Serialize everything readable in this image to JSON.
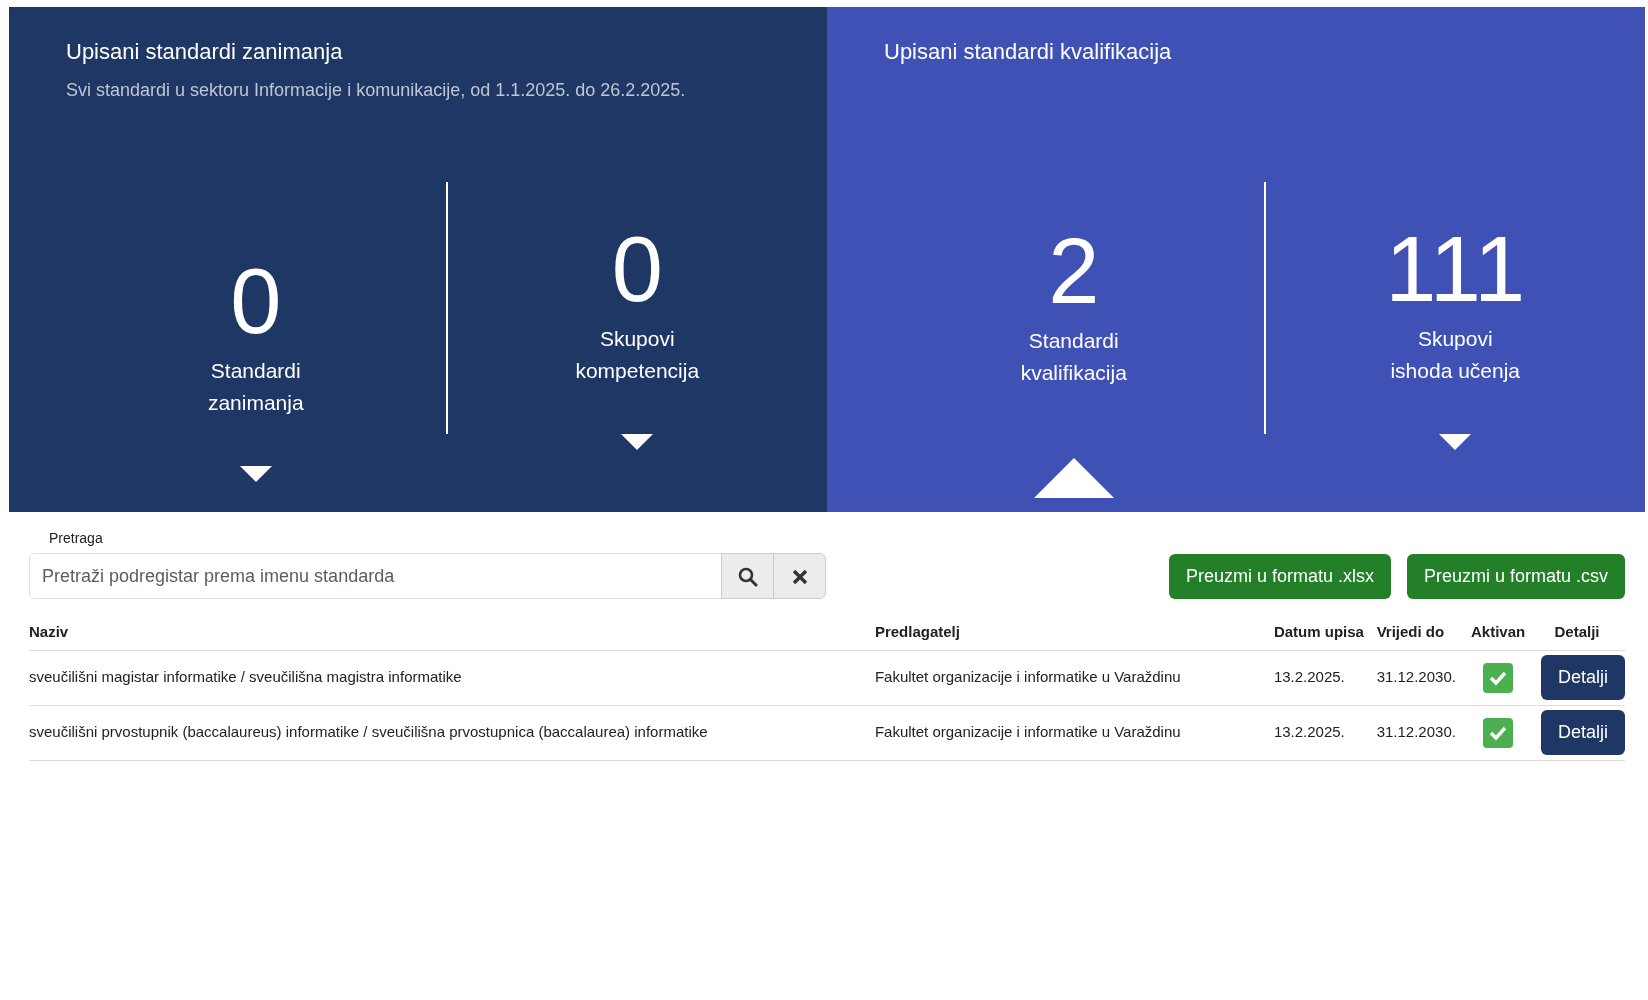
{
  "panels": [
    {
      "title": "Upisani standardi zanimanja",
      "subtitle": "Svi standardi u sektoru Informacije i komunikacije, od 1.1.2025. do 26.2.2025.",
      "stats": [
        {
          "value": "0",
          "label": "Standardi zanimanja",
          "selected": false
        },
        {
          "value": "0",
          "label": "Skupovi kompetencija",
          "selected": false
        }
      ]
    },
    {
      "title": "Upisani standardi kvalifikacija",
      "stats": [
        {
          "value": "2",
          "label": "Standardi kvalifikacija",
          "selected": true
        },
        {
          "value": "111",
          "label": "Skupovi ishoda učenja",
          "selected": false
        }
      ]
    }
  ],
  "search": {
    "label": "Pretraga",
    "placeholder": "Pretraži podregistar prema imenu standarda"
  },
  "downloads": [
    "Preuzmi u formatu .xlsx",
    "Preuzmi u formatu .csv"
  ],
  "table": {
    "columns": [
      "Naziv",
      "Predlagatelj",
      "Datum upisa",
      "Vrijedi do",
      "Aktivan",
      "Detalji"
    ],
    "rows": [
      {
        "name": "sveučilišni magistar informatike / sveučilišna magistra informatike",
        "proposer": "Fakultet organizacije i informatike u Varaždinu",
        "date": "13.2.2025.",
        "valid_until": "31.12.2030.",
        "active": true,
        "action": "Detalji"
      },
      {
        "name": "sveučilišni prvostupnik (baccalaureus) informatike / sveučilišna prvostupnica (baccalaurea) informatike",
        "proposer": "Fakultet organizacije i informatike u Varaždinu",
        "date": "13.2.2025.",
        "valid_until": "31.12.2030.",
        "active": true,
        "action": "Detalji"
      }
    ]
  }
}
